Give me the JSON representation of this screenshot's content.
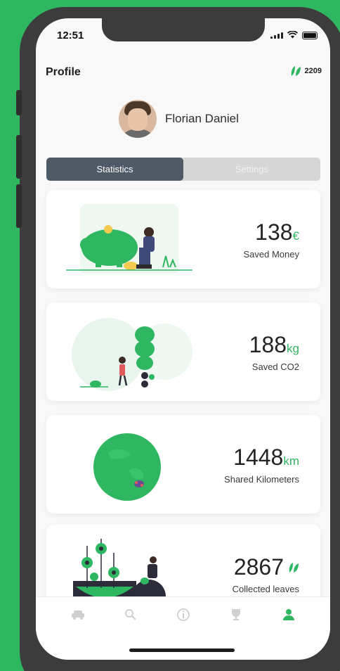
{
  "status_bar": {
    "time": "12:51"
  },
  "header": {
    "title": "Profile",
    "leaf_count": "2209"
  },
  "profile": {
    "name": "Florian Daniel"
  },
  "tabs": [
    {
      "label": "Statistics"
    },
    {
      "label": "Settings"
    }
  ],
  "cards": [
    {
      "value": "138",
      "unit": "€",
      "label": "Saved Money",
      "illustration": "piggy-bank-illustration"
    },
    {
      "value": "188",
      "unit": "kg",
      "label": "Saved CO2",
      "illustration": "tree-illustration"
    },
    {
      "value": "1448",
      "unit": "km",
      "label": "Shared Kilometers",
      "illustration": "world-map-illustration"
    },
    {
      "value": "2867",
      "unit": "",
      "label": "Collected leaves",
      "illustration": "plants-illustration"
    }
  ],
  "tab_bar": [
    {
      "icon": "car-icon"
    },
    {
      "icon": "search-icon"
    },
    {
      "icon": "info-icon"
    },
    {
      "icon": "trophy-icon"
    },
    {
      "icon": "user-icon"
    }
  ],
  "colors": {
    "accent": "#2fb660",
    "background": "#2fb660",
    "tab_active": "#4e5a66"
  }
}
